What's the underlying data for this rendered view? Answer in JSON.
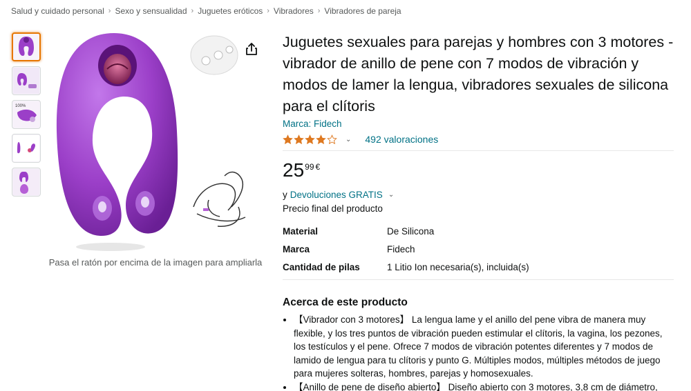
{
  "breadcrumb": [
    "Salud y cuidado personal",
    "Sexo y sensualidad",
    "Juguetes eróticos",
    "Vibradores",
    "Vibradores de pareja"
  ],
  "breadcrumb_sep": "›",
  "gallery": {
    "hover_hint": "Pasa el ratón por encima de la imagen para ampliarla",
    "thumb_badge": "100%"
  },
  "product": {
    "title": "Juguetes sexuales para parejas y hombres con 3 motores - vibrador de anillo de pene con 7 modos de vibración y modos de lamer la lengua, vibradores sexuales de silicona para el clítoris",
    "brand": "Marca: Fidech",
    "rating_value": 4.0,
    "ratings_count": "492 valoraciones",
    "price_whole": "25",
    "price_fraction": "99",
    "price_currency": "€",
    "returns_prefix": "y",
    "returns_link": "Devoluciones GRATIS",
    "final_price_label": "Precio final del producto"
  },
  "specs": [
    {
      "key": "Material",
      "value": "De Silicona"
    },
    {
      "key": "Marca",
      "value": "Fidech"
    },
    {
      "key": "Cantidad de pilas",
      "value": "1 Litio Ion necesaria(s), incluida(s)"
    }
  ],
  "about": {
    "title": "Acerca de este producto",
    "bullets": [
      "【Vibrador con 3 motores】 La lengua lame y el anillo del pene vibra de manera muy flexible, y los tres puntos de vibración pueden estimular el clítoris, la vagina, los pezones, los testículos y el pene. Ofrece 7 modos de vibración potentes diferentes y 7 modos de lamido de lengua para tu clítoris y punto G. Múltiples modos, múltiples métodos de juego para mujeres solteras, hombres, parejas y homosexuales.",
      "【Anillo de pene de diseño abierto】 Diseño abierto con 3 motores, 3,8 cm de diámetro, apto para pene de cualquier tamaño superior a 3,8 cm. El anillo del pene está equipado"
    ]
  },
  "colors": {
    "link": "#007185",
    "star": "#de7921",
    "product_purple": "#9b3fc8"
  }
}
